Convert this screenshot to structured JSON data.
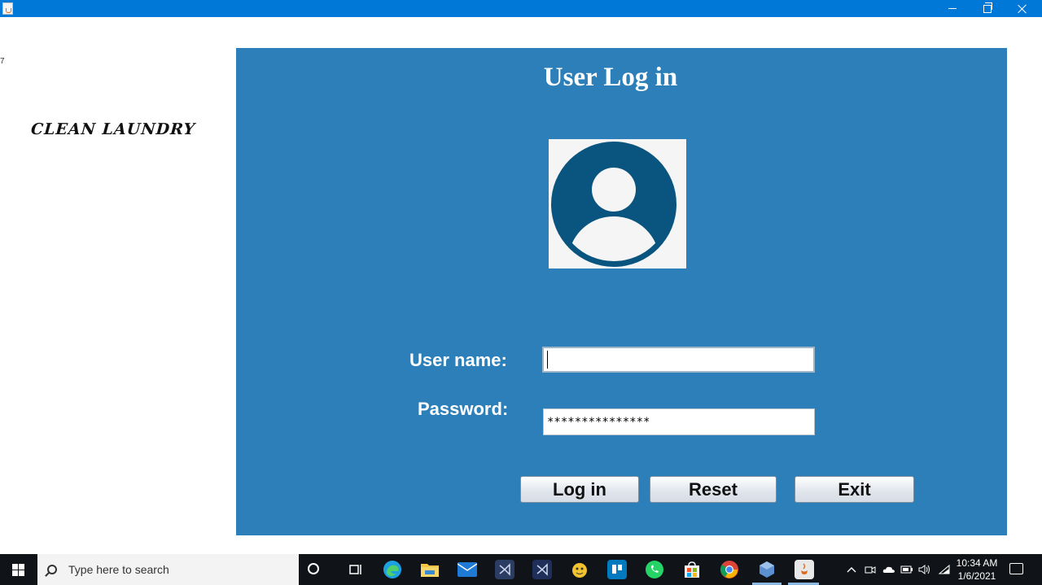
{
  "window": {
    "minimize_label": "",
    "maximize_label": "",
    "close_label": ""
  },
  "stray_mark": "7",
  "brand": {
    "text": "CLEAN LAUNDRY"
  },
  "login": {
    "title": "User Log in",
    "username_label": "User name:",
    "username_value": "",
    "password_label": "Password:",
    "password_value": "***************",
    "buttons": {
      "login": "Log in",
      "reset": "Reset",
      "exit": "Exit"
    }
  },
  "colors": {
    "titlebar": "#0078d7",
    "panel": "#2c7fb8",
    "avatar": "#0a557f",
    "taskbar": "#101418"
  },
  "taskbar": {
    "search_placeholder": "Type here to search",
    "pinned": [
      "cortana-icon",
      "task-view-icon",
      "edge-icon",
      "file-explorer-icon",
      "mail-icon",
      "visual-studio-icon",
      "visual-studio-icon",
      "app-icon",
      "trello-icon",
      "whatsapp-icon",
      "store-icon",
      "chrome-icon",
      "virtualbox-icon",
      "java-icon"
    ],
    "time": "10:34 AM",
    "date": "1/6/2021"
  }
}
